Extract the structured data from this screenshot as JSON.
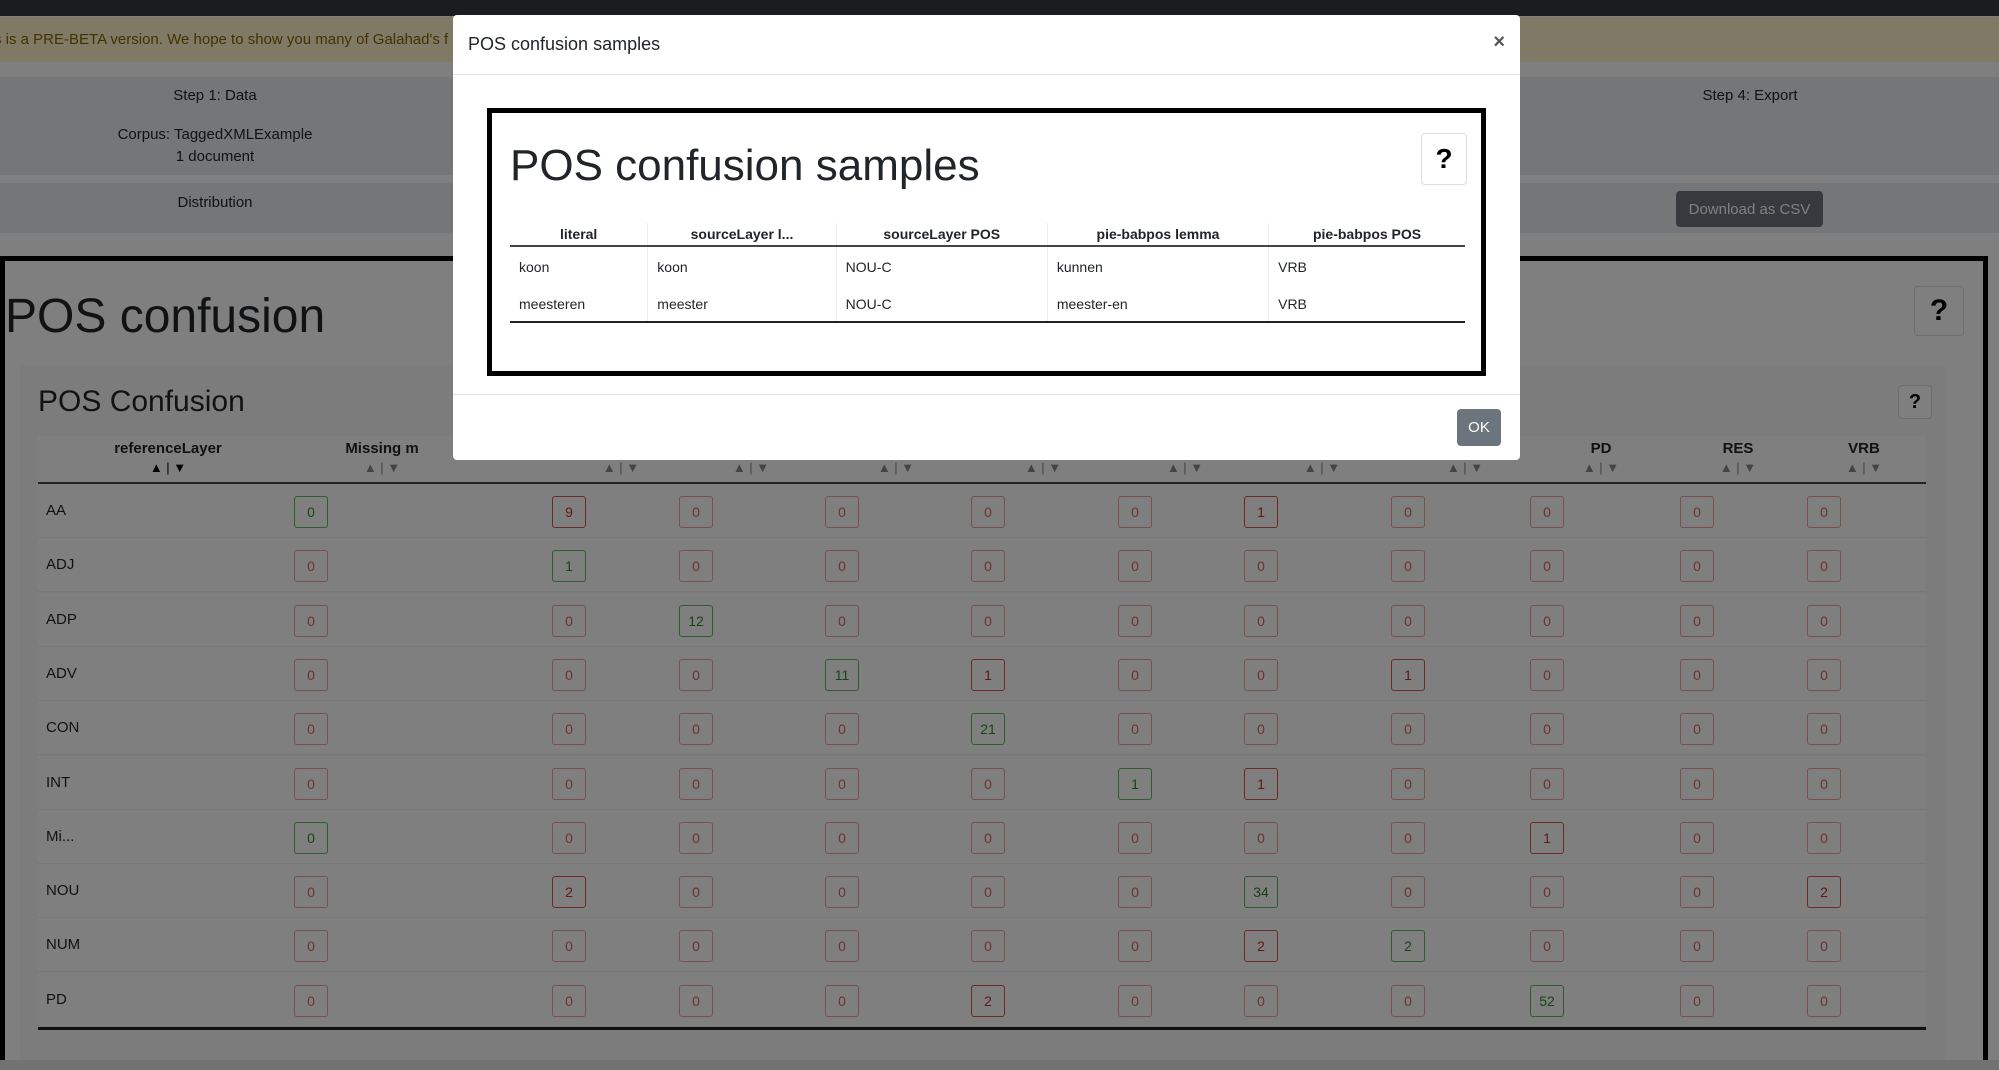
{
  "banner": {
    "text": "s is a PRE-BETA version. We hope to show you many of Galahad's f"
  },
  "steps": {
    "step1": "Step 1: Data",
    "step4": "Step 4: Export",
    "corpus": "Corpus: TaggedXMLExample",
    "documents": "1 document"
  },
  "tabs": {
    "distribution": "Distribution",
    "download_csv": "Download as CSV"
  },
  "panel": {
    "title": "POS confusion",
    "help": "?"
  },
  "inner": {
    "title": "POS Confusion",
    "help": "?"
  },
  "grid": {
    "headers": [
      "referenceLayer",
      "Missing m",
      "",
      "",
      "",
      "",
      "",
      "",
      "",
      "PD",
      "RES",
      "VRB"
    ],
    "sort": "▲ | ▼",
    "rows": [
      {
        "label": "AA",
        "values": [
          "0",
          "9",
          "0",
          "0",
          "0",
          "0",
          "1",
          "0",
          "0",
          "0",
          "0"
        ]
      },
      {
        "label": "ADJ",
        "values": [
          "0",
          "1",
          "0",
          "0",
          "0",
          "0",
          "0",
          "0",
          "0",
          "0",
          "0"
        ]
      },
      {
        "label": "ADP",
        "values": [
          "0",
          "0",
          "12",
          "0",
          "0",
          "0",
          "0",
          "0",
          "0",
          "0",
          "0"
        ]
      },
      {
        "label": "ADV",
        "values": [
          "0",
          "0",
          "0",
          "11",
          "1",
          "0",
          "0",
          "1",
          "0",
          "0",
          "0"
        ]
      },
      {
        "label": "CON",
        "values": [
          "0",
          "0",
          "0",
          "0",
          "21",
          "0",
          "0",
          "0",
          "0",
          "0",
          "0"
        ]
      },
      {
        "label": "INT",
        "values": [
          "0",
          "0",
          "0",
          "0",
          "0",
          "1",
          "1",
          "0",
          "0",
          "0",
          "0"
        ]
      },
      {
        "label": "Mi...",
        "values": [
          "0",
          "0",
          "0",
          "0",
          "0",
          "0",
          "0",
          "0",
          "1",
          "0",
          "0"
        ]
      },
      {
        "label": "NOU",
        "values": [
          "0",
          "2",
          "0",
          "0",
          "0",
          "0",
          "34",
          "0",
          "0",
          "0",
          "2"
        ]
      },
      {
        "label": "NUM",
        "values": [
          "0",
          "0",
          "0",
          "0",
          "0",
          "0",
          "2",
          "2",
          "0",
          "0",
          "0"
        ]
      },
      {
        "label": "PD",
        "values": [
          "0",
          "0",
          "0",
          "0",
          "2",
          "0",
          "0",
          "0",
          "52",
          "0",
          "0"
        ]
      }
    ],
    "diagonal": [
      [
        0,
        0
      ],
      [
        1,
        1
      ],
      [
        2,
        2
      ],
      [
        3,
        3
      ],
      [
        4,
        4
      ],
      [
        5,
        5
      ],
      [
        6,
        0
      ],
      [
        7,
        6
      ],
      [
        8,
        7
      ],
      [
        9,
        8
      ]
    ]
  },
  "modal": {
    "header_title": "POS confusion samples",
    "close": "×",
    "body_title": "POS confusion samples",
    "help": "?",
    "columns": [
      "literal",
      "sourceLayer l...",
      "sourceLayer POS",
      "pie-babpos lemma",
      "pie-babpos POS"
    ],
    "rows": [
      [
        "koon",
        "koon",
        "NOU-C",
        "kunnen",
        "VRB"
      ],
      [
        "meesteren",
        "meester",
        "NOU-C",
        "meester-en",
        "VRB"
      ]
    ],
    "ok": "OK"
  }
}
